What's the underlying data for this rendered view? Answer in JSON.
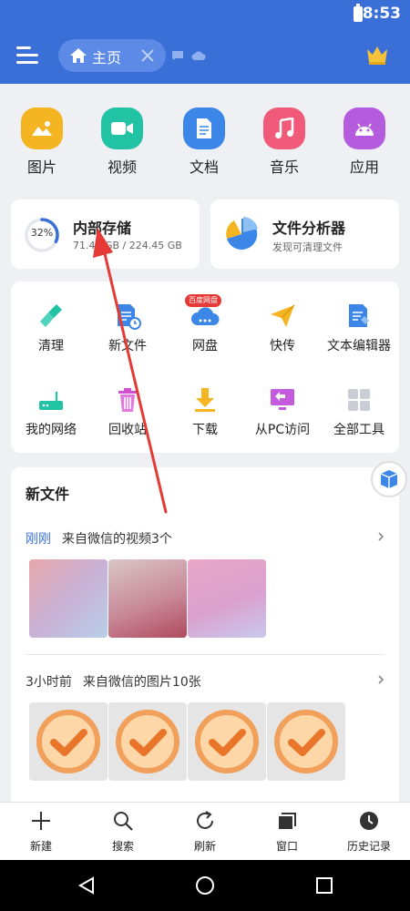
{
  "status_bar": {
    "time": "8:53"
  },
  "header": {
    "tab_label": "主页",
    "icons": [
      "menu-icon",
      "home-icon",
      "close-icon",
      "chat-icon",
      "cloud-icon",
      "crown-icon"
    ]
  },
  "categories": [
    {
      "label": "图片",
      "icon": "image-icon",
      "color": "#f5b422"
    },
    {
      "label": "视频",
      "icon": "video-icon",
      "color": "#22c2a4"
    },
    {
      "label": "文档",
      "icon": "document-icon",
      "color": "#3b86e6"
    },
    {
      "label": "音乐",
      "icon": "music-icon",
      "color": "#f05a78"
    },
    {
      "label": "应用",
      "icon": "android-icon",
      "color": "#b45bde"
    }
  ],
  "storage": {
    "title": "内部存储",
    "used_percent": 32,
    "percent_label": "32%",
    "usage": "71.41 GB / 224.45 GB"
  },
  "analyzer": {
    "title": "文件分析器",
    "subtitle": "发现可清理文件"
  },
  "tools": [
    {
      "label": "清理",
      "icon": "broom-icon"
    },
    {
      "label": "新文件",
      "icon": "new-file-icon"
    },
    {
      "label": "网盘",
      "icon": "cloud-disk-icon",
      "badge": "百度网盘"
    },
    {
      "label": "快传",
      "icon": "paper-plane-icon"
    },
    {
      "label": "文本编辑器",
      "icon": "text-editor-icon"
    },
    {
      "label": "我的网络",
      "icon": "router-icon"
    },
    {
      "label": "回收站",
      "icon": "trash-icon"
    },
    {
      "label": "下载",
      "icon": "download-icon"
    },
    {
      "label": "从PC访问",
      "icon": "pc-access-icon"
    },
    {
      "label": "全部工具",
      "icon": "grid-icon"
    }
  ],
  "new_files": {
    "title": "新文件",
    "groups": [
      {
        "time": "刚刚",
        "desc": "来自微信的视频3个",
        "thumb_kind": "video",
        "count": 3
      },
      {
        "time": "3小时前",
        "desc": "来自微信的图片10张",
        "thumb_kind": "check-image",
        "count": 4
      }
    ]
  },
  "bottom_toolbar": [
    {
      "label": "新建",
      "icon": "plus-icon"
    },
    {
      "label": "搜索",
      "icon": "search-icon"
    },
    {
      "label": "刷新",
      "icon": "refresh-icon"
    },
    {
      "label": "窗口",
      "icon": "windows-icon"
    },
    {
      "label": "历史记录",
      "icon": "history-icon"
    }
  ],
  "nav": {
    "icons": [
      "back-icon",
      "home-circle-icon",
      "recents-icon"
    ]
  },
  "colors": {
    "primary": "#3b6fd8",
    "background": "#eef0f4",
    "annotation": "#e53935"
  }
}
